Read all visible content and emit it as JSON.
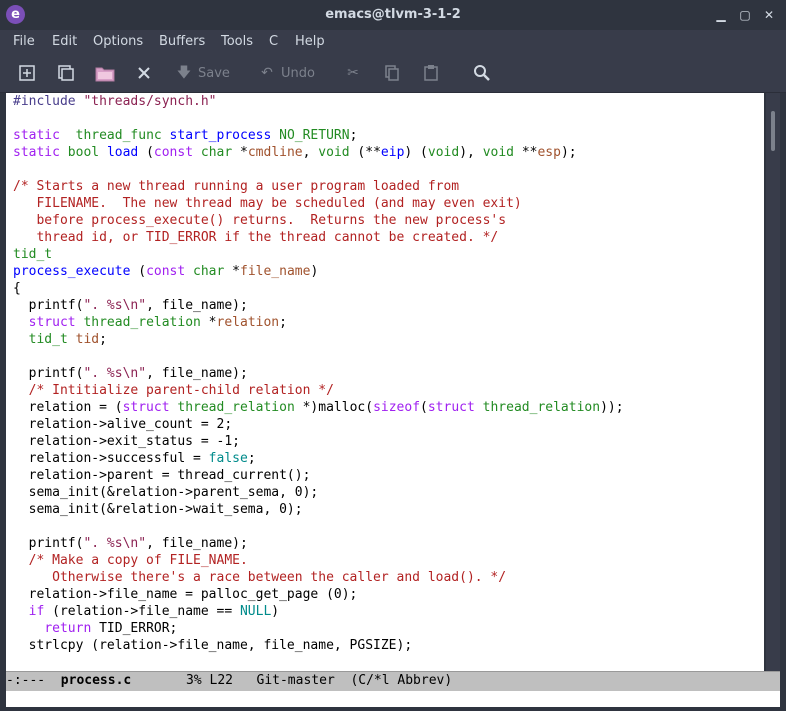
{
  "window": {
    "title": "emacs@tlvm-3-1-2",
    "app_icon": "e"
  },
  "menu": [
    "File",
    "Edit",
    "Options",
    "Buffers",
    "Tools",
    "C",
    "Help"
  ],
  "toolbar": {
    "save_label": "Save",
    "undo_label": "Undo"
  },
  "code_lines": [
    [
      [
        "pp",
        "#include "
      ],
      [
        "st",
        "\"threads/synch.h\""
      ]
    ],
    [],
    [
      [
        "kw",
        "static"
      ],
      [
        "",
        "  "
      ],
      [
        "ty",
        "thread_func"
      ],
      [
        "",
        " "
      ],
      [
        "fn",
        "start_process"
      ],
      [
        "",
        " "
      ],
      [
        "ty",
        "NO_RETURN"
      ],
      [
        "",
        ";"
      ]
    ],
    [
      [
        "kw",
        "static"
      ],
      [
        "",
        " "
      ],
      [
        "ty",
        "bool"
      ],
      [
        "",
        " "
      ],
      [
        "fn",
        "load"
      ],
      [
        "",
        " ("
      ],
      [
        "kw",
        "const"
      ],
      [
        "",
        " "
      ],
      [
        "ty",
        "char"
      ],
      [
        "",
        " *"
      ],
      [
        "var",
        "cmdline"
      ],
      [
        "",
        ", "
      ],
      [
        "ty",
        "void"
      ],
      [
        "",
        " (**"
      ],
      [
        "fn",
        "eip"
      ],
      [
        "",
        ") ("
      ],
      [
        "ty",
        "void"
      ],
      [
        "",
        "), "
      ],
      [
        "ty",
        "void"
      ],
      [
        "",
        " **"
      ],
      [
        "var",
        "esp"
      ],
      [
        "",
        ");"
      ]
    ],
    [],
    [
      [
        "cm",
        "/* Starts a new thread running a user program loaded from"
      ]
    ],
    [
      [
        "cm",
        "   FILENAME.  The new thread may be scheduled (and may even exit)"
      ]
    ],
    [
      [
        "cm",
        "   before process_execute() returns.  Returns the new process's"
      ]
    ],
    [
      [
        "cm",
        "   thread id, or TID_ERROR if the thread cannot be created. */"
      ]
    ],
    [
      [
        "ty",
        "tid_t"
      ]
    ],
    [
      [
        "fn",
        "process_execute"
      ],
      [
        "",
        " ("
      ],
      [
        "kw",
        "const"
      ],
      [
        "",
        " "
      ],
      [
        "ty",
        "char"
      ],
      [
        "",
        " *"
      ],
      [
        "var",
        "file_name"
      ],
      [
        "",
        ")"
      ]
    ],
    [
      [
        "",
        "{"
      ]
    ],
    [
      [
        "",
        "  printf("
      ],
      [
        "st",
        "\". %s\\n\""
      ],
      [
        "",
        ", file_name);"
      ]
    ],
    [
      [
        "",
        "  "
      ],
      [
        "kw",
        "struct"
      ],
      [
        "",
        " "
      ],
      [
        "ty",
        "thread_relation"
      ],
      [
        "",
        " *"
      ],
      [
        "var",
        "relation"
      ],
      [
        "",
        ";"
      ]
    ],
    [
      [
        "",
        "  "
      ],
      [
        "ty",
        "tid_t"
      ],
      [
        "",
        " "
      ],
      [
        "var",
        "tid"
      ],
      [
        "",
        ";"
      ]
    ],
    [],
    [
      [
        "",
        "  printf("
      ],
      [
        "st",
        "\". %s\\n\""
      ],
      [
        "",
        ", file_name);"
      ]
    ],
    [
      [
        "",
        "  "
      ],
      [
        "cm",
        "/* Intitialize parent-child relation */"
      ]
    ],
    [
      [
        "",
        "  relation = ("
      ],
      [
        "kw",
        "struct"
      ],
      [
        "",
        " "
      ],
      [
        "ty",
        "thread_relation"
      ],
      [
        "",
        " *)malloc("
      ],
      [
        "kw",
        "sizeof"
      ],
      [
        "",
        "("
      ],
      [
        "kw",
        "struct"
      ],
      [
        "",
        " "
      ],
      [
        "ty",
        "thread_relation"
      ],
      [
        "",
        "));"
      ]
    ],
    [
      [
        "",
        "  relation->alive_count = 2;"
      ]
    ],
    [
      [
        "",
        "  relation->exit_status = -1;"
      ]
    ],
    [
      [
        "",
        "  relation->successful = "
      ],
      [
        "cn",
        "false"
      ],
      [
        "",
        ";"
      ]
    ],
    [
      [
        "",
        "  relation->parent = thread_current();"
      ]
    ],
    [
      [
        "",
        "  sema_init(&relation->parent_sema, 0);"
      ]
    ],
    [
      [
        "",
        "  sema_init(&relation->wait_sema, 0);"
      ]
    ],
    [],
    [
      [
        "",
        "  printf("
      ],
      [
        "st",
        "\". %s\\n\""
      ],
      [
        "",
        ", file_name);"
      ]
    ],
    [
      [
        "",
        "  "
      ],
      [
        "cm",
        "/* Make a copy of FILE_NAME."
      ]
    ],
    [
      [
        "cm",
        "     Otherwise there's a race between the caller and load(). */"
      ]
    ],
    [
      [
        "",
        "  relation->file_name = palloc_get_page (0);"
      ]
    ],
    [
      [
        "",
        "  "
      ],
      [
        "kw",
        "if"
      ],
      [
        "",
        " (relation->file_name == "
      ],
      [
        "cn",
        "NULL"
      ],
      [
        "",
        ")"
      ]
    ],
    [
      [
        "",
        "    "
      ],
      [
        "kw",
        "return"
      ],
      [
        "",
        " TID_ERROR;"
      ]
    ],
    [
      [
        "",
        "  strlcpy (relation->file_name, file_name, PGSIZE);"
      ]
    ]
  ],
  "modeline": {
    "status": "-:---  ",
    "buffer": "process.c",
    "position": "3% L22",
    "vc": "Git-master",
    "modes": "(C/*l Abbrev)"
  },
  "icons": {
    "new_file": "new-file-icon",
    "open_dir": "open-directory-icon",
    "open_file": "open-file-icon",
    "close": "close-icon",
    "save": "save-icon",
    "undo": "undo-icon",
    "cut": "cut-icon",
    "copy": "copy-icon",
    "paste": "paste-icon",
    "search": "search-icon"
  }
}
